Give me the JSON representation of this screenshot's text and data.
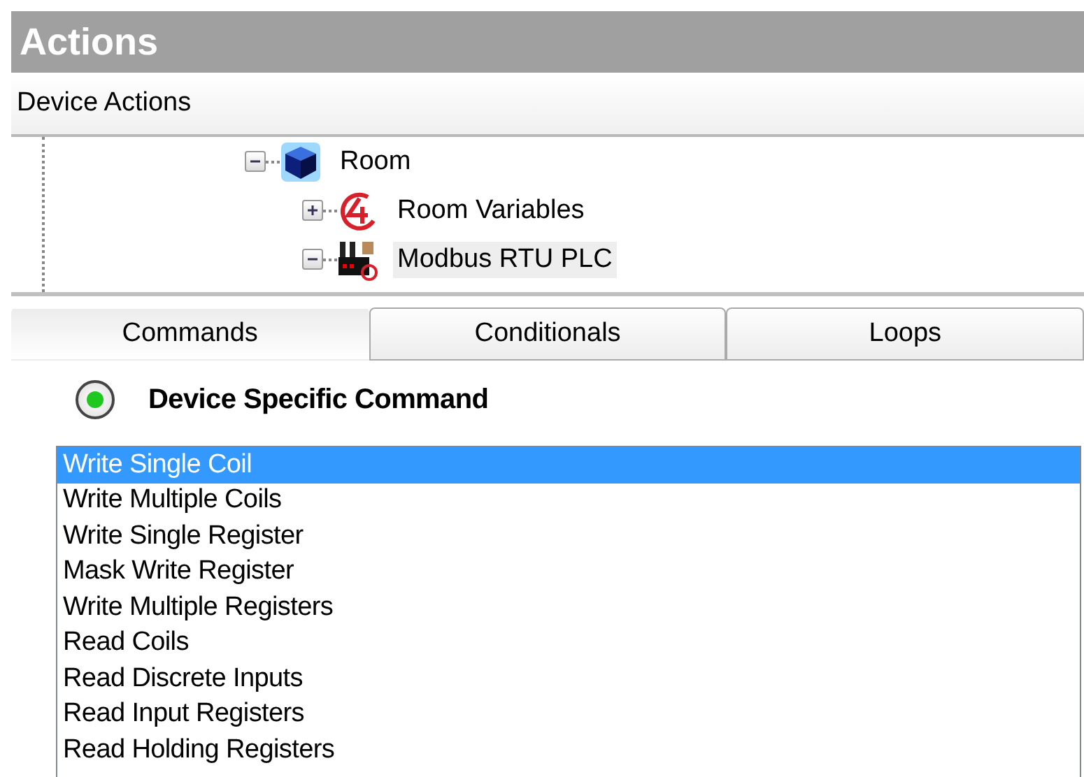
{
  "panel": {
    "title": "Actions"
  },
  "tree": {
    "header": "Device Actions",
    "items": [
      {
        "label": "Room",
        "kind": "room",
        "expanded": true,
        "selected": false,
        "children": [
          {
            "label": "Room Variables",
            "kind": "variables",
            "expanded": false,
            "selected": false
          },
          {
            "label": "Modbus RTU PLC",
            "kind": "device",
            "expanded": true,
            "selected": true
          }
        ]
      }
    ]
  },
  "tabs": [
    {
      "label": "Commands",
      "selected": true
    },
    {
      "label": "Conditionals",
      "selected": false
    },
    {
      "label": "Loops",
      "selected": false
    }
  ],
  "command_type": {
    "label": "Device Specific Command",
    "checked": true
  },
  "commands": [
    {
      "label": "Write Single Coil",
      "selected": true
    },
    {
      "label": "Write Multiple Coils",
      "selected": false
    },
    {
      "label": "Write Single Register",
      "selected": false
    },
    {
      "label": "Mask Write Register",
      "selected": false
    },
    {
      "label": "Write Multiple Registers",
      "selected": false
    },
    {
      "label": "Read Coils",
      "selected": false
    },
    {
      "label": "Read Discrete Inputs",
      "selected": false
    },
    {
      "label": "Read Input Registers",
      "selected": false
    },
    {
      "label": "Read Holding Registers",
      "selected": false
    }
  ]
}
